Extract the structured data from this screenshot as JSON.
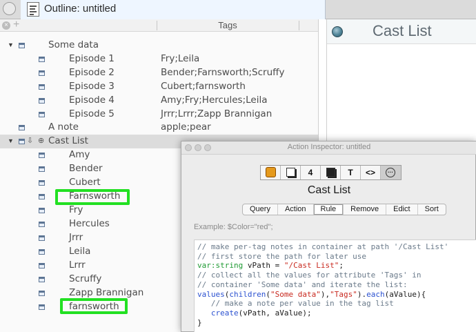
{
  "tab": {
    "title": "Outline: untitled"
  },
  "outline": {
    "column_header": "Tags",
    "rows": [
      {
        "label": "Some data",
        "tags": ""
      },
      {
        "label": "Episode 1",
        "tags": "Fry;Leila"
      },
      {
        "label": "Episode 2",
        "tags": "Bender;Farnsworth;Scruffy"
      },
      {
        "label": "Episode 3",
        "tags": "Cubert;farnsworth"
      },
      {
        "label": "Episode 4",
        "tags": "Amy;Fry;Hercules;Leila"
      },
      {
        "label": "Episode 5",
        "tags": "Jrrr;Lrrr;Zapp Brannigan"
      },
      {
        "label": "A note",
        "tags": "apple;pear"
      },
      {
        "label": "Cast List",
        "tags": ""
      },
      {
        "label": "Amy"
      },
      {
        "label": "Bender"
      },
      {
        "label": "Cubert"
      },
      {
        "label": "Farnsworth"
      },
      {
        "label": "Fry"
      },
      {
        "label": "Hercules"
      },
      {
        "label": "Jrrr"
      },
      {
        "label": "Leila"
      },
      {
        "label": "Lrrr"
      },
      {
        "label": "Scruffy"
      },
      {
        "label": "Zapp Brannigan"
      },
      {
        "label": "farnsworth"
      }
    ]
  },
  "text_pane": {
    "title": "Cast List"
  },
  "inspector": {
    "window_title": "Action Inspector: untitled",
    "toolbar_icons": [
      "hand-icon",
      "appearance-icon",
      "number-four-icon",
      "shadow-icon",
      "text-icon",
      "code-icon",
      "more-icon"
    ],
    "toolbar_glyphs": {
      "text": "T",
      "code": "<>",
      "number": "4",
      "more": "···"
    },
    "note_name": "Cast List",
    "tabs": [
      "Query",
      "Action",
      "Rule",
      "Remove",
      "Edict",
      "Sort"
    ],
    "active_tab": "Rule",
    "example_text": "Example: $Color=\"red\";",
    "code_lines": [
      "// make per-tag notes in container at path '/Cast List'",
      "// first store the path for later use",
      "var:string vPath = \"/Cast List\";",
      "// collect all the values for attribute 'Tags' in",
      "// container 'Some data' and iterate the list:",
      "values(children(\"Some data\"),\"Tags\").each(aValue){",
      "   // make a note per value in the tag list",
      "   create(vPath, aValue);",
      "}"
    ]
  },
  "colors": {
    "highlight": "#22e022",
    "code_comment": "#6a7a8a",
    "code_keyword": "#1e9a32",
    "code_function": "#2a50d0",
    "code_string": "#c8281e"
  }
}
